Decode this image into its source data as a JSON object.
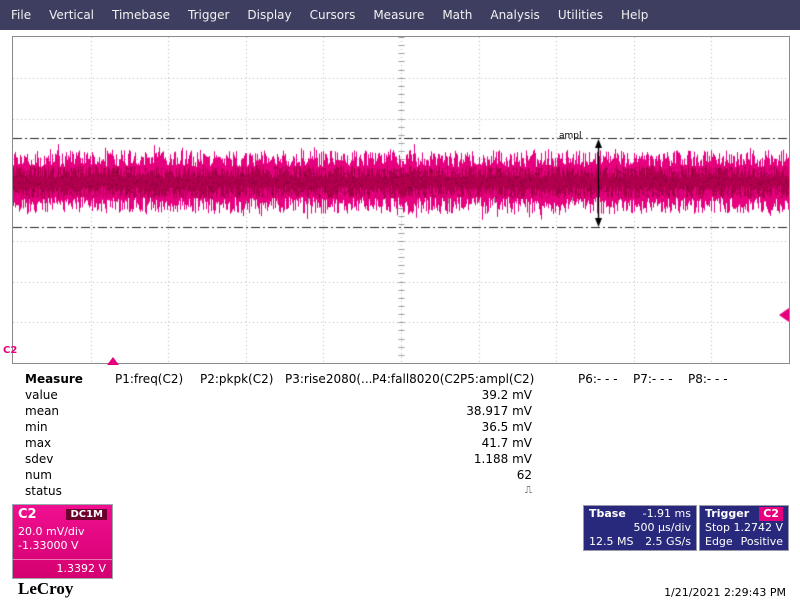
{
  "colors": {
    "channel": "#e6007e",
    "channel_core": "#b2004e",
    "menu_bg": "#3e3e60",
    "info_bg": "#28287c"
  },
  "menu": {
    "items": [
      "File",
      "Vertical",
      "Timebase",
      "Trigger",
      "Display",
      "Cursors",
      "Measure",
      "Math",
      "Analysis",
      "Utilities",
      "Help"
    ]
  },
  "waveform": {
    "channel_label": "C2",
    "ampl_label": "ampl"
  },
  "measure_table": {
    "title": "Measure",
    "columns": [
      "P1:freq(C2)",
      "P2:pkpk(C2)",
      "P3:rise2080(...",
      "P4:fall8020(C2)",
      "P5:ampl(C2)",
      "P6:- - -",
      "P7:- - -",
      "P8:- - -"
    ],
    "rows": [
      "value",
      "mean",
      "min",
      "max",
      "sdev",
      "num",
      "status"
    ],
    "p5_values": [
      "39.2 mV",
      "38.917 mV",
      "36.5 mV",
      "41.7 mV",
      "1.188 mV",
      "62",
      "⎍"
    ]
  },
  "channel_box": {
    "name": "C2",
    "coupling": "DC1M",
    "scale": "20.0 mV/div",
    "offset": "-1.33000 V",
    "level": "1.3392 V"
  },
  "timebase_box": {
    "label": "Tbase",
    "delay": "-1.91 ms",
    "scale": "500 µs/div",
    "samples": "12.5 MS",
    "rate": "2.5 GS/s"
  },
  "trigger_box": {
    "label": "Trigger",
    "source": "C2",
    "mode": "Stop",
    "level": "1.2742 V",
    "type": "Edge",
    "slope": "Positive"
  },
  "footer": {
    "logo": "LeCroy",
    "datetime": "1/21/2021 2:29:43 PM"
  }
}
